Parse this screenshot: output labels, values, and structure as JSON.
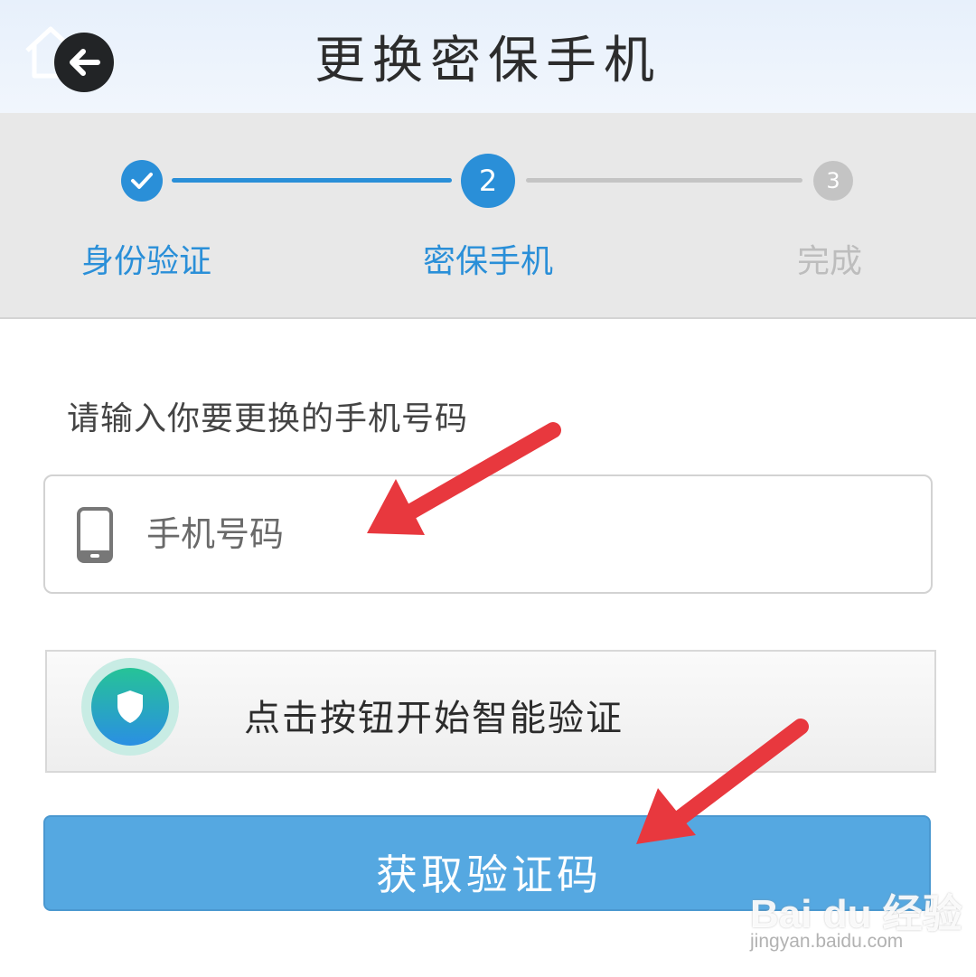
{
  "header": {
    "title": "更换密保手机",
    "back_icon": "arrow-left-icon"
  },
  "stepper": {
    "steps": [
      {
        "number": "",
        "label": "身份验证",
        "state": "done",
        "icon": "check-icon"
      },
      {
        "number": "2",
        "label": "密保手机",
        "state": "active"
      },
      {
        "number": "3",
        "label": "完成",
        "state": "pending"
      }
    ]
  },
  "form": {
    "section_label": "请输入你要更换的手机号码",
    "phone_placeholder": "手机号码",
    "phone_value": "",
    "phone_icon": "mobile-phone-icon"
  },
  "smart_verify": {
    "label": "点击按钮开始智能验证",
    "icon": "shield-icon"
  },
  "submit": {
    "label": "获取验证码"
  },
  "watermark": {
    "logo_text": "Bai du 经验",
    "url": "jingyan.baidu.com"
  },
  "colors": {
    "accent_blue": "#2a8fd8",
    "button_blue": "#55a8e1",
    "pending_gray": "#c4c4c4",
    "annotation_red": "#e8383e",
    "stepper_bg": "#e8e8e8"
  }
}
